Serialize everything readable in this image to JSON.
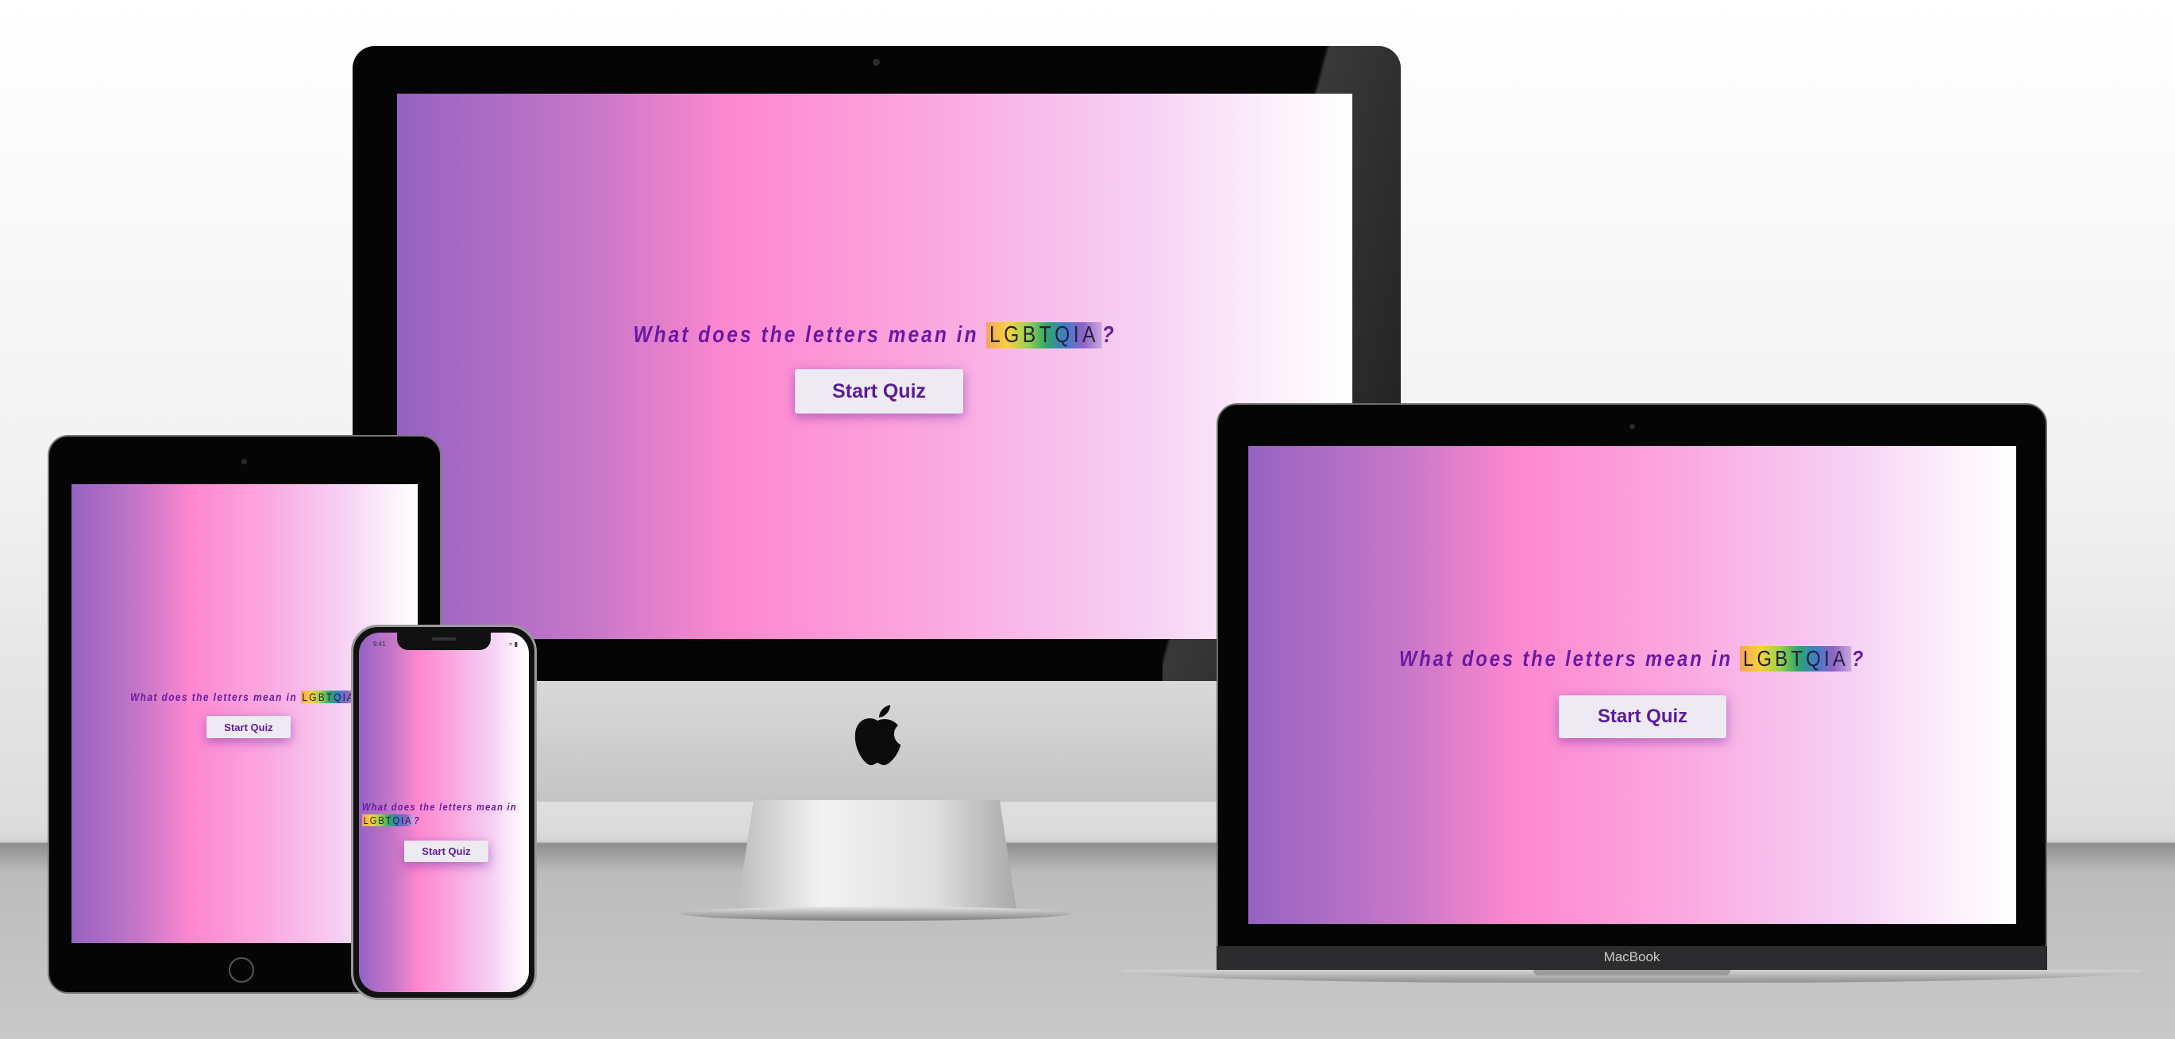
{
  "headline": {
    "prefix": "What does the letters mean in",
    "acronym": "LGBTQIA",
    "suffix": "?"
  },
  "start_button_label": "Start Quiz",
  "laptop_brand": "MacBook",
  "phone": {
    "status_time": "9:41"
  },
  "colors": {
    "headline": "#6a1aa3",
    "button_text": "#5b1c98",
    "button_bg": "#eeeaf1",
    "gradient": [
      "#9562c2",
      "#fe88cf",
      "#f6d0f4",
      "#ffffff"
    ]
  }
}
